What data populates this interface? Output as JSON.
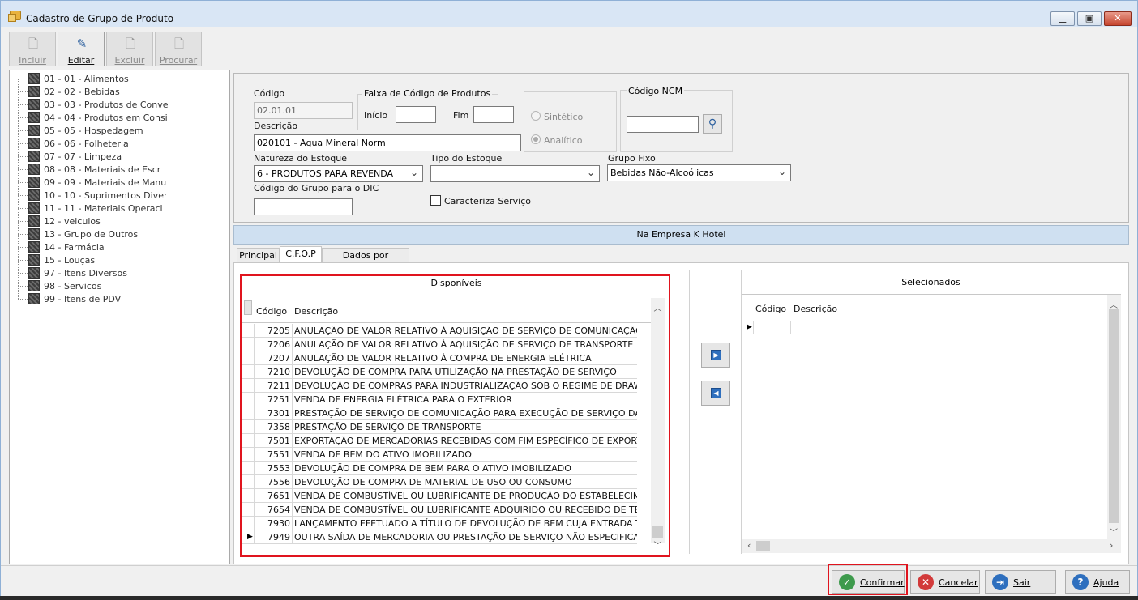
{
  "window": {
    "title": "Cadastro de Grupo de Produto",
    "min": "▁",
    "max": "▣",
    "close": "✕"
  },
  "toolbar": [
    {
      "label": "Incluir",
      "icon": "new-doc-icon",
      "glyph": "🗋",
      "active": false
    },
    {
      "label": "Editar",
      "icon": "edit-icon",
      "glyph": "✎",
      "active": true
    },
    {
      "label": "Excluir",
      "icon": "delete-icon",
      "glyph": "🗋",
      "active": false
    },
    {
      "label": "Procurar",
      "icon": "search-doc-icon",
      "glyph": "🗋",
      "active": false
    }
  ],
  "tree": [
    "01 - 01 - Alimentos",
    "02 - 02 - Bebidas",
    "03 - 03 - Produtos de Conve",
    "04 - 04 - Produtos em Consi",
    "05 - 05 - Hospedagem",
    "06 - 06 - Folheteria",
    "07 - 07 - Limpeza",
    "08 - 08 - Materiais de Escr",
    "09 - 09 - Materiais de Manu",
    "10 - 10 - Suprimentos Diver",
    "11 - 11 - Materiais Operaci",
    "12 - veiculos",
    "13 - Grupo de Outros",
    "14 - Farmácia",
    "15 - Louças",
    "97 - Itens Diversos",
    "98 - Servicos",
    "99 - Itens de PDV"
  ],
  "form": {
    "codigo_label": "Código",
    "codigo_value": "02.01.01",
    "descricao_label": "Descrição",
    "descricao_value": "020101 - Agua Mineral Norm",
    "faixa_label": "Faixa de Código de Produtos",
    "inicio_label": "Início",
    "inicio_value": "",
    "fim_label": "Fim",
    "fim_value": "",
    "sintetico_label": "Sintético",
    "analitico_label": "Analítico",
    "ncm_label": "Código NCM",
    "ncm_value": "",
    "natureza_label": "Natureza do Estoque",
    "natureza_value": "6 - PRODUTOS PARA REVENDA",
    "tipo_label": "Tipo do Estoque",
    "tipo_value": "",
    "grupo_fixo_label": "Grupo Fixo",
    "grupo_fixo_value": "Bebidas Não-Alcoólicas",
    "dic_label": "Código do Grupo para o DIC",
    "dic_value": "",
    "servico_label": "Caracteriza Serviço",
    "servico_checked": false
  },
  "band": "Na Empresa K Hotel",
  "tabs": [
    "Principal",
    "C.F.O.P",
    "Dados por Empresa"
  ],
  "active_tab": "C.F.O.P",
  "disponiveis": {
    "title": "Disponíveis",
    "col_codigo": "Código",
    "col_descricao": "Descrição",
    "rows": [
      {
        "codigo": "7205",
        "descricao": "ANULAÇÃO DE VALOR RELATIVO À AQUISIÇÃO DE SERVIÇO DE COMUNICAÇÃO"
      },
      {
        "codigo": "7206",
        "descricao": "ANULAÇÃO DE VALOR RELATIVO À AQUISIÇÃO DE SERVIÇO DE TRANSPORTE"
      },
      {
        "codigo": "7207",
        "descricao": "ANULAÇÃO DE VALOR RELATIVO À COMPRA DE ENERGIA ELÉTRICA"
      },
      {
        "codigo": "7210",
        "descricao": "DEVOLUÇÃO DE COMPRA PARA UTILIZAÇÃO NA PRESTAÇÃO DE SERVIÇO"
      },
      {
        "codigo": "7211",
        "descricao": "DEVOLUÇÃO DE COMPRAS PARA INDUSTRIALIZAÇÃO SOB O REGIME DE DRAWBAC"
      },
      {
        "codigo": "7251",
        "descricao": "VENDA DE ENERGIA ELÉTRICA PARA O EXTERIOR"
      },
      {
        "codigo": "7301",
        "descricao": "PRESTAÇÃO DE SERVIÇO DE COMUNICAÇÃO PARA EXECUÇÃO DE SERVIÇO DA MES"
      },
      {
        "codigo": "7358",
        "descricao": "PRESTAÇÃO DE SERVIÇO DE TRANSPORTE"
      },
      {
        "codigo": "7501",
        "descricao": "EXPORTAÇÃO DE MERCADORIAS RECEBIDAS COM FIM ESPECÍFICO DE EXPORTAÇÃO"
      },
      {
        "codigo": "7551",
        "descricao": "VENDA DE BEM DO ATIVO IMOBILIZADO"
      },
      {
        "codigo": "7553",
        "descricao": "DEVOLUÇÃO DE COMPRA DE BEM PARA O ATIVO IMOBILIZADO"
      },
      {
        "codigo": "7556",
        "descricao": "DEVOLUÇÃO DE COMPRA DE MATERIAL DE USO OU CONSUMO"
      },
      {
        "codigo": "7651",
        "descricao": "VENDA DE COMBUSTÍVEL OU LUBRIFICANTE DE PRODUÇÃO DO ESTABELECIMENTO"
      },
      {
        "codigo": "7654",
        "descricao": "VENDA DE COMBUSTÍVEL OU LUBRIFICANTE ADQUIRIDO OU RECEBIDO DE TERCEIF"
      },
      {
        "codigo": "7930",
        "descricao": "LANÇAMENTO EFETUADO A TÍTULO DE DEVOLUÇÃO DE BEM CUJA ENTRADA TENHA"
      },
      {
        "codigo": "7949",
        "descricao": "OUTRA SAÍDA DE MERCADORIA OU PRESTAÇÃO DE SERVIÇO NÃO ESPECIFICADO",
        "current": true
      }
    ]
  },
  "selecionados": {
    "title": "Selecionados",
    "col_codigo": "Código",
    "col_descricao": "Descrição",
    "rows": []
  },
  "move_buttons": {
    "add": "▶",
    "remove": "◀"
  },
  "footer": [
    {
      "label": "Confirmar",
      "icon": "check-icon",
      "glyph": "✓",
      "color": "#3e9a4c",
      "highlight": true
    },
    {
      "label": "Cancelar",
      "icon": "cancel-icon",
      "glyph": "✕",
      "color": "#d23a3a"
    },
    {
      "label": "Sair",
      "icon": "exit-icon",
      "glyph": "⇥",
      "color": "#2e6fbe"
    },
    {
      "label": "Ajuda",
      "icon": "help-icon",
      "glyph": "?",
      "color": "#2e6fbe"
    }
  ],
  "colors": {
    "highlight": "#e0141e",
    "band": "#cfe0f1"
  }
}
